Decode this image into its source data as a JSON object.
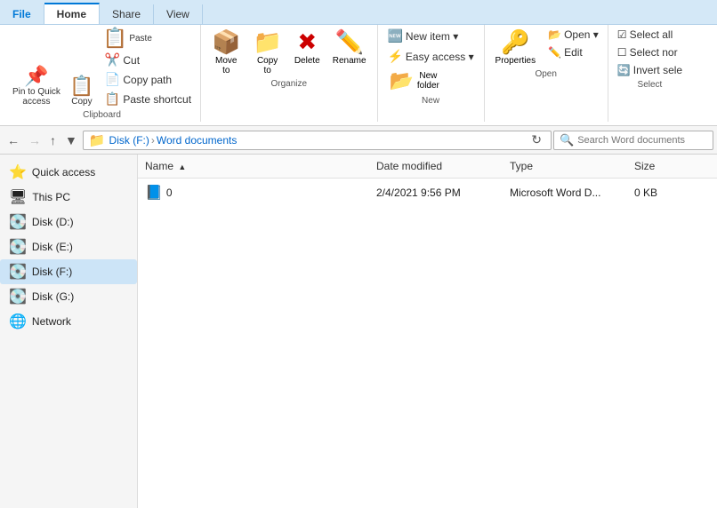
{
  "tabs": [
    {
      "id": "file",
      "label": "File",
      "active": false
    },
    {
      "id": "home",
      "label": "Home",
      "active": true
    },
    {
      "id": "share",
      "label": "Share",
      "active": false
    },
    {
      "id": "view",
      "label": "View",
      "active": false
    }
  ],
  "ribbon": {
    "clipboard": {
      "label": "Clipboard",
      "pin_label": "Pin to Quick\naccess",
      "copy_label": "Copy",
      "paste_label": "Paste",
      "cut_label": "Cut",
      "copy_path_label": "Copy path",
      "paste_shortcut_label": "Paste shortcut"
    },
    "organize": {
      "label": "Organize",
      "move_label": "Move\nto",
      "copy_label": "Copy\nto",
      "delete_label": "Delete",
      "rename_label": "Rename"
    },
    "new": {
      "label": "New",
      "new_item_label": "New item ▾",
      "easy_access_label": "Easy access ▾",
      "new_folder_label": "New\nfolder"
    },
    "open": {
      "label": "Open",
      "open_label": "Open ▾",
      "edit_label": "Edit",
      "properties_label": "Properties"
    },
    "select": {
      "label": "Select",
      "select_all_label": "Select all",
      "select_none_label": "Select nor",
      "invert_label": "Invert sele"
    }
  },
  "navigation": {
    "back_disabled": false,
    "forward_disabled": true,
    "up_disabled": false,
    "path_parts": [
      "Disk (F:)",
      "Word documents"
    ],
    "search_placeholder": "Search Word documents"
  },
  "sidebar": {
    "items": [
      {
        "id": "quick-access",
        "label": "Quick access",
        "icon": "⭐",
        "selected": false
      },
      {
        "id": "this-pc",
        "label": "This PC",
        "icon": "🖥",
        "selected": false
      },
      {
        "id": "disk-d",
        "label": "Disk (D:)",
        "icon": "💾",
        "selected": false
      },
      {
        "id": "disk-e",
        "label": "Disk (E:)",
        "icon": "💾",
        "selected": false
      },
      {
        "id": "disk-f",
        "label": "Disk (F:)",
        "icon": "💾",
        "selected": true
      },
      {
        "id": "disk-g",
        "label": "Disk (G:)",
        "icon": "💾",
        "selected": false
      },
      {
        "id": "network",
        "label": "Network",
        "icon": "🌐",
        "selected": false
      }
    ]
  },
  "file_list": {
    "columns": [
      {
        "id": "name",
        "label": "Name",
        "sort": "asc"
      },
      {
        "id": "date",
        "label": "Date modified"
      },
      {
        "id": "type",
        "label": "Type"
      },
      {
        "id": "size",
        "label": "Size"
      }
    ],
    "files": [
      {
        "name": "0",
        "date": "2/4/2021 9:56 PM",
        "type": "Microsoft Word D...",
        "size": "0 KB",
        "icon": "📄"
      }
    ]
  }
}
